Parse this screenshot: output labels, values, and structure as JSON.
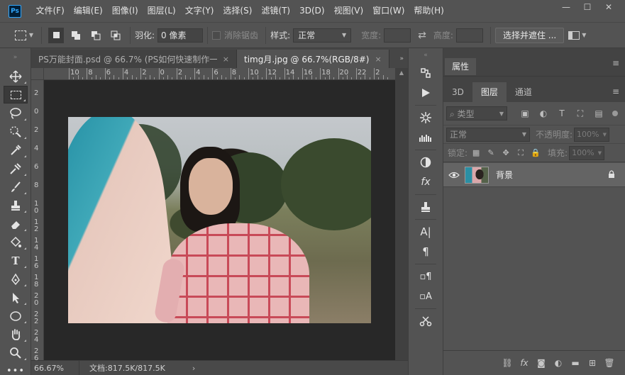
{
  "app": {
    "logo": "Ps"
  },
  "menu": [
    "文件(F)",
    "编辑(E)",
    "图像(I)",
    "图层(L)",
    "文字(Y)",
    "选择(S)",
    "滤镜(T)",
    "3D(D)",
    "视图(V)",
    "窗口(W)",
    "帮助(H)"
  ],
  "window_controls": {
    "minimize": "—",
    "maximize": "☐",
    "close": "✕"
  },
  "options": {
    "feather_label": "羽化:",
    "feather_value": "0 像素",
    "antialias_label": "消除锯齿",
    "style_label": "样式:",
    "style_value": "正常",
    "width_label": "宽度:",
    "height_label": "高度:",
    "swap_icon": "⇄",
    "select_mask_button": "选择并遮住 ..."
  },
  "tabs": [
    {
      "label": "PS万能封面.psd @ 66.7% (PS如何快速制作一...",
      "close": "×"
    },
    {
      "label": "timg月.jpg @ 66.7%(RGB/8#)",
      "close": "×"
    }
  ],
  "ruler_top": [
    "10",
    "8",
    "6",
    "4",
    "2",
    "0",
    "2",
    "4",
    "6",
    "8",
    "10",
    "12",
    "14",
    "16",
    "18",
    "20",
    "22",
    "2"
  ],
  "ruler_left": [
    "2",
    "0",
    "2",
    "4",
    "6",
    "8",
    "1\n0",
    "1\n2",
    "1\n4",
    "1\n6",
    "1\n8",
    "2\n0",
    "2\n2",
    "2\n4",
    "2\n6"
  ],
  "status": {
    "zoom": "66.67%",
    "doc": "文档:817.5K/817.5K",
    "arrow": "›"
  },
  "panels": {
    "properties_title": "属性",
    "layer_tabs": [
      "3D",
      "图层",
      "通道"
    ],
    "kind_label": "类型",
    "blend_mode": "正常",
    "opacity_label": "不透明度:",
    "opacity_value": "100%",
    "lock_label": "锁定:",
    "fill_label": "填充:",
    "fill_value": "100%",
    "layers": [
      {
        "name": "背景",
        "visible": true,
        "locked": true
      }
    ],
    "menu_icon": "≡"
  },
  "colors": {
    "accent": "#31a8ff",
    "panel_bg": "#535353",
    "canvas_bg": "#282828"
  }
}
